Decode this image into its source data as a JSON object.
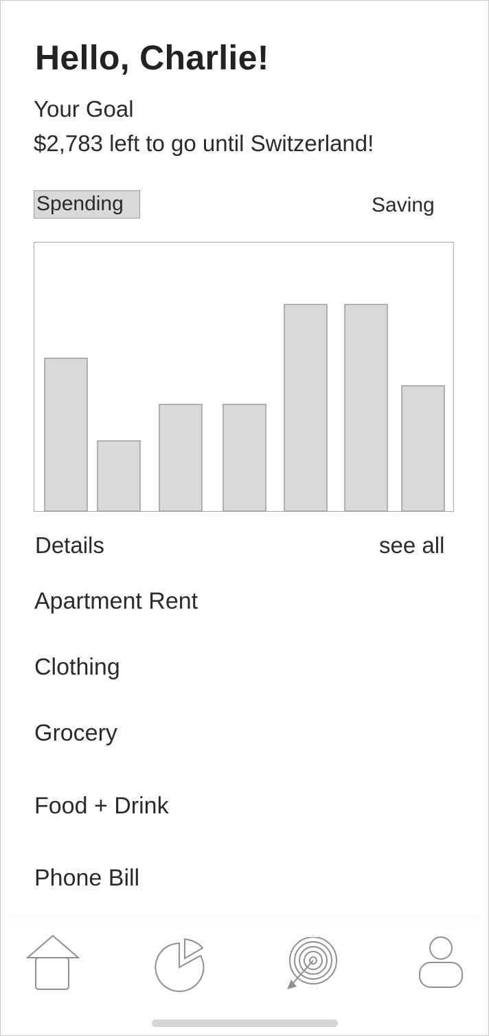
{
  "header": {
    "greeting": "Hello, Charlie!",
    "goal_label": "Your Goal",
    "goal_text": "$2,783 left to go until Switzerland!"
  },
  "tabs": {
    "spending": "Spending",
    "saving": "Saving",
    "active": "Spending"
  },
  "chart_data": {
    "type": "bar",
    "categories": [
      "",
      "",
      "",
      "",
      "",
      "",
      ""
    ],
    "values": [
      222,
      102,
      155,
      155,
      300,
      300,
      182
    ],
    "ylim": [
      0,
      390
    ],
    "grid": false,
    "colors": {
      "fill": "#d9d9d9",
      "stroke": "#9c9c9c",
      "frame": "#a8a8a8"
    }
  },
  "details": {
    "label": "Details",
    "see_all": "see all",
    "items": [
      "Apartment Rent",
      "Clothing",
      "Grocery",
      "Food + Drink",
      "Phone Bill"
    ]
  },
  "bottom_nav": {
    "items": [
      {
        "icon": "home-icon"
      },
      {
        "icon": "pie-chart-icon"
      },
      {
        "icon": "target-icon"
      },
      {
        "icon": "profile-icon"
      }
    ]
  },
  "colors": {
    "line": "#8f8f8f",
    "tab_active_bg": "#d9d9d9",
    "text": "#2a2a2a"
  }
}
